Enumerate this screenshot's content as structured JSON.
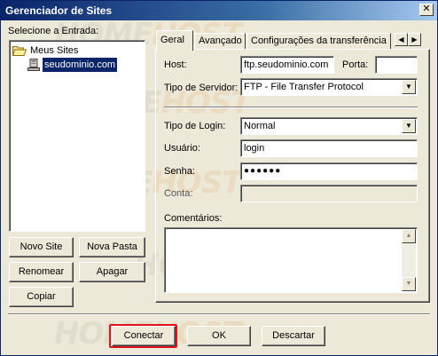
{
  "window": {
    "title": "Gerenciador de Sites",
    "close_glyph": "✕"
  },
  "watermark": {
    "part1": "HOME",
    "part2": "HOST"
  },
  "left": {
    "select_label": "Selecione a Entrada:",
    "tree": {
      "root": "Meus Sites",
      "child": "seudominio.com"
    },
    "buttons": {
      "new_site": "Novo Site",
      "new_folder": "Nova Pasta",
      "rename": "Renomear",
      "delete": "Apagar",
      "copy": "Copiar"
    }
  },
  "tabs": {
    "general": "Geral",
    "advanced": "Avançado",
    "transfer": "Configurações da transferência",
    "scroll_left": "◀",
    "scroll_right": "▶"
  },
  "form": {
    "host_label": "Host:",
    "host_value": "ftp.seudominio.com",
    "port_label": "Porta:",
    "port_value": "",
    "server_type_label": "Tipo de Servidor:",
    "server_type_value": "FTP - File Transfer Protocol",
    "login_type_label": "Tipo de Login:",
    "login_type_value": "Normal",
    "user_label": "Usuário:",
    "user_value": "login",
    "password_label": "Senha:",
    "password_value": "●●●●●●",
    "account_label": "Conta:",
    "account_value": "",
    "comments_label": "Comentários:",
    "comments_value": "",
    "dropdown_glyph": "▼",
    "scroll_up_glyph": "▲",
    "scroll_down_glyph": "▼"
  },
  "footer": {
    "connect": "Conectar",
    "ok": "OK",
    "discard": "Descartar"
  },
  "colors": {
    "highlight": "#e0121b",
    "selection": "#0a246a"
  }
}
